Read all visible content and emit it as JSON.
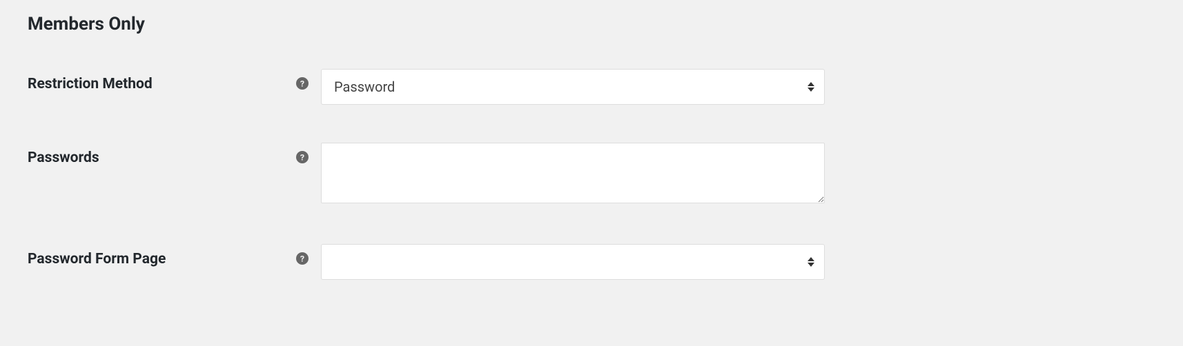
{
  "section": {
    "title": "Members Only"
  },
  "fields": {
    "restriction_method": {
      "label": "Restriction Method",
      "value": "Password"
    },
    "passwords": {
      "label": "Passwords",
      "value": ""
    },
    "password_form_page": {
      "label": "Password Form Page",
      "value": ""
    }
  }
}
